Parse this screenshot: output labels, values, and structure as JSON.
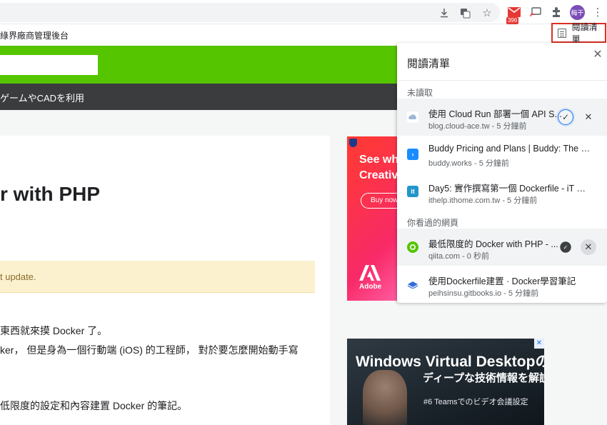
{
  "toolbar": {
    "icons": [
      "download-icon",
      "translate-icon",
      "star-icon",
      "gmail-icon",
      "cast-icon",
      "extensions-icon",
      "more-icon"
    ],
    "ext_badge": "396",
    "avatar_label": "梅干"
  },
  "bookmarks": {
    "item_text": "綠界廠商管理後台",
    "reading_list_label": "閱讀清單"
  },
  "page": {
    "nav_text": "ゲームやCADを利用",
    "headline": "r with PHP",
    "alert_text": "t update.",
    "body_lines": [
      "東西就來摸 Docker 了。",
      "ker， 但是身為一個行動端 (iOS) 的工程師， 對於要怎麼開始動手寫",
      "低限度的設定和內容建置 Docker 的筆記。"
    ]
  },
  "ads": {
    "adobe": {
      "text_line1": "See wh",
      "text_line2": "Creativ",
      "button": "Buy now",
      "brand": "Adobe"
    },
    "wvd": {
      "title": "Windows Virtual Desktopの",
      "subtitle": "ディープな技術情報を解説",
      "tag": "#6 Teamsでのビデオ会議設定"
    }
  },
  "reading_list": {
    "title": "閱讀清單",
    "unread_label": "未讀取",
    "read_label": "你看過的網頁",
    "unread": [
      {
        "title": "使用 Cloud Run 部署一個 API S...",
        "meta": "blog.cloud-ace.tw - 5 分鐘前",
        "icon": "cloud-ace-icon",
        "color": "#ffffff"
      },
      {
        "title": "Buddy Pricing and Plans | Buddy: The Dev...",
        "meta": "buddy.works - 5 分鐘前",
        "icon": "buddy-icon",
        "color": "#1a8cff"
      },
      {
        "title": "Day5: 實作撰寫第一個 Dockerfile - iT 邦幫...",
        "meta": "ithelp.ithome.com.tw - 5 分鐘前",
        "icon": "ithelp-icon",
        "color": "#2196c9"
      }
    ],
    "read": [
      {
        "title": "最低限度的 Docker with PHP - ...",
        "meta": "qiita.com - 0 秒前",
        "icon": "qiita-icon",
        "color": "#55c500"
      },
      {
        "title": "使用Dockerfile建置 · Docker學習筆記",
        "meta": "peihsinsu.gitbooks.io - 5 分鐘前",
        "icon": "gitbook-icon",
        "color": "#346ddb"
      }
    ]
  }
}
